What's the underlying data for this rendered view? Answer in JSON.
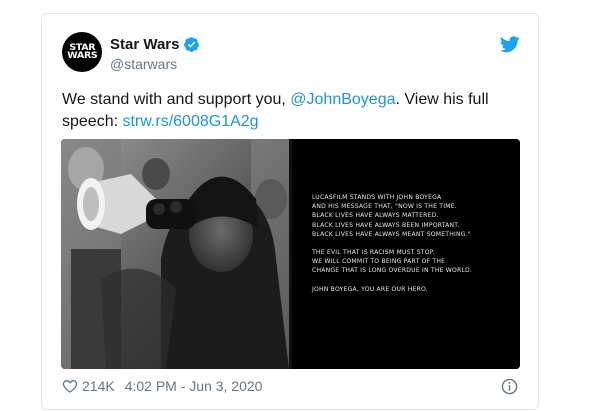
{
  "tweet": {
    "author_name": "Star Wars",
    "author_handle": "@starwars",
    "avatar_text_line1": "STAR",
    "avatar_text_line2": "WARS",
    "text_intro": "We stand with and support you, ",
    "mention": "@JohnBoyega",
    "text_middle": ". View his full speech: ",
    "link": "strw.rs/6008G1A2g",
    "likes": "214K",
    "timestamp": "4:02 PM - Jun 3, 2020"
  },
  "media": {
    "panel_lines_1": [
      "LUCASFILM STANDS WITH JOHN BOYEGA",
      "AND HIS MESSAGE THAT, \"NOW IS THE TIME.",
      "BLACK LIVES HAVE ALWAYS MATTERED.",
      "BLACK LIVES HAVE ALWAYS BEEN IMPORTANT.",
      "BLACK LIVES HAVE ALWAYS MEANT SOMETHING.\""
    ],
    "panel_lines_2": [
      "THE EVIL THAT IS RACISM MUST STOP.",
      "WE WILL COMMIT TO BEING PART OF THE",
      "CHANGE THAT IS LONG OVERDUE IN THE WORLD."
    ],
    "panel_line_3": "JOHN BOYEGA, YOU ARE OUR HERO."
  },
  "colors": {
    "link": "#1b95e0",
    "verified": "#1da1f2",
    "text": "#14171a",
    "muted": "#657786"
  },
  "icons": [
    "verified-badge-icon",
    "twitter-bird-icon",
    "heart-icon",
    "info-icon"
  ]
}
